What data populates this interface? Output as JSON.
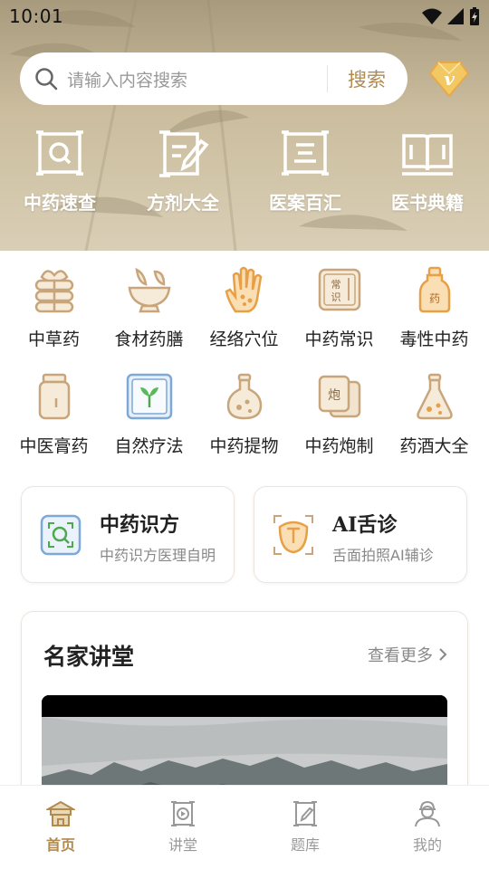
{
  "status_bar": {
    "time": "10:01"
  },
  "search": {
    "placeholder": "请输入内容搜索",
    "button_label": "搜索"
  },
  "vip": {
    "icon": "vip-diamond-icon",
    "letter": "v"
  },
  "quick_links": [
    {
      "label": "中药速查",
      "icon": "herb-search-scroll-icon"
    },
    {
      "label": "方剂大全",
      "icon": "prescription-edit-icon"
    },
    {
      "label": "医案百汇",
      "icon": "case-scroll-icon"
    },
    {
      "label": "医书典籍",
      "icon": "open-book-icon"
    }
  ],
  "categories": [
    {
      "label": "中草药",
      "icon": "herb-bundle-icon"
    },
    {
      "label": "食材药膳",
      "icon": "mortar-bowl-icon"
    },
    {
      "label": "经络穴位",
      "icon": "hand-acupoint-icon"
    },
    {
      "label": "中药常识",
      "icon": "knowledge-card-icon",
      "glyph": "常识"
    },
    {
      "label": "毒性中药",
      "icon": "poison-bottle-icon",
      "glyph": "药"
    },
    {
      "label": "中医膏药",
      "icon": "ointment-jar-icon"
    },
    {
      "label": "自然疗法",
      "icon": "leaf-frame-icon"
    },
    {
      "label": "中药提物",
      "icon": "flask-icon"
    },
    {
      "label": "中药炮制",
      "icon": "processing-cards-icon",
      "glyph": "炮"
    },
    {
      "label": "药酒大全",
      "icon": "wine-flask-icon"
    }
  ],
  "features": [
    {
      "title": "中药识方",
      "subtitle": "中药识方医理自明",
      "icon": "scan-herb-icon"
    },
    {
      "title": "AI舌诊",
      "subtitle": "舌面拍照AI辅诊",
      "icon": "tongue-scan-icon"
    }
  ],
  "lecture": {
    "title": "名家讲堂",
    "more_label": "查看更多"
  },
  "bottom_nav": [
    {
      "label": "首页",
      "icon": "home-temple-icon",
      "active": true
    },
    {
      "label": "讲堂",
      "icon": "lecture-play-icon",
      "active": false
    },
    {
      "label": "题库",
      "icon": "question-bank-icon",
      "active": false
    },
    {
      "label": "我的",
      "icon": "profile-icon",
      "active": false
    }
  ],
  "colors": {
    "accent": "#b08a4e",
    "header_bg": "#cbbd9e",
    "icon_tan": "#c8a57a"
  }
}
